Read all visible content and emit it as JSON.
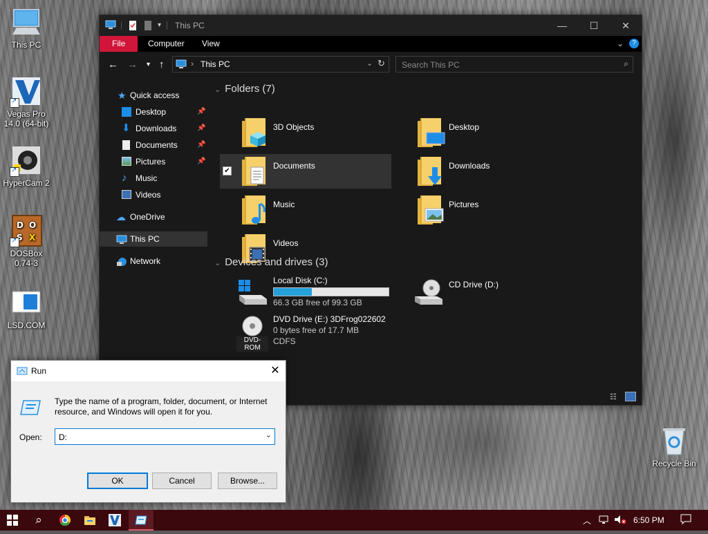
{
  "desktop": {
    "icons": [
      {
        "label": "This PC",
        "icon": "this-pc-icon"
      },
      {
        "label": "Vegas Pro 14.0 (64-bit)",
        "icon": "vegas-pro-icon"
      },
      {
        "label": "HyperCam 2",
        "icon": "hypercam-icon"
      },
      {
        "label": "DOSBox 0.74-3",
        "icon": "dosbox-icon"
      },
      {
        "label": "LSD.COM",
        "icon": "lsd-com-icon"
      },
      {
        "label": "Recycle Bin",
        "icon": "recycle-bin-icon"
      }
    ]
  },
  "explorer": {
    "title": "This PC",
    "ribbon_tabs": [
      "File",
      "Computer",
      "View"
    ],
    "address": "This PC",
    "search_placeholder": "Search This PC",
    "nav": {
      "quick_access": "Quick access",
      "items": [
        "Desktop",
        "Downloads",
        "Documents",
        "Pictures",
        "Music",
        "Videos"
      ],
      "onedrive": "OneDrive",
      "this_pc": "This PC",
      "network": "Network"
    },
    "folders_header": "Folders (7)",
    "folders": [
      "3D Objects",
      "Desktop",
      "Documents",
      "Downloads",
      "Music",
      "Pictures",
      "Videos"
    ],
    "selected_folder": "Documents",
    "devices_header": "Devices and drives (3)",
    "drives": {
      "c": {
        "name": "Local Disk (C:)",
        "free": "66.3 GB free of 99.3 GB",
        "used_fraction": 0.332
      },
      "d": {
        "name": "CD Drive (D:)"
      },
      "e": {
        "name": "DVD Drive (E:) 3DFrog022602",
        "free": "0 bytes free of 17.7 MB",
        "fs": "CDFS",
        "badge": "DVD-ROM"
      }
    }
  },
  "run": {
    "title": "Run",
    "description": "Type the name of a program, folder, document, or Internet resource, and Windows will open it for you.",
    "open_label": "Open:",
    "open_value": "D:",
    "ok": "OK",
    "cancel": "Cancel",
    "browse": "Browse..."
  },
  "taskbar": {
    "time": "6:50 PM",
    "accent": "#3a080d"
  }
}
